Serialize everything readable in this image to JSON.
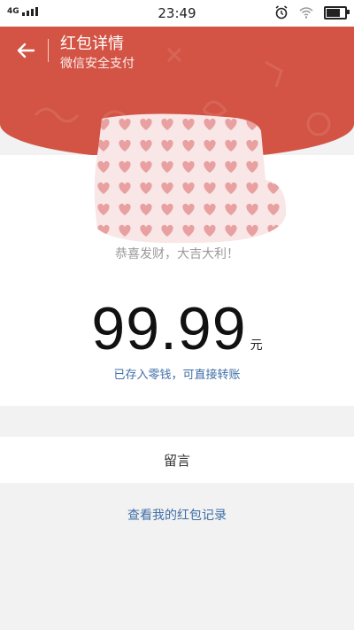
{
  "status_bar": {
    "network": "4G",
    "time": "23:49",
    "icons": [
      "alarm-icon",
      "wifi-icon",
      "battery-icon"
    ]
  },
  "header": {
    "title": "红包详情",
    "subtitle": "微信安全支付",
    "back_icon": "back-arrow-icon",
    "color": "#d35445"
  },
  "sender": {
    "greeting": "恭喜发财，大吉大利！"
  },
  "amount": {
    "value": "99.99",
    "unit": "元",
    "note": "已存入零钱，可直接转账"
  },
  "message": {
    "label": "留言"
  },
  "history": {
    "link": "查看我的红包记录"
  },
  "colors": {
    "accent_red": "#d35445",
    "link_blue": "#3f6ea8",
    "background": "#f2f2f2"
  }
}
